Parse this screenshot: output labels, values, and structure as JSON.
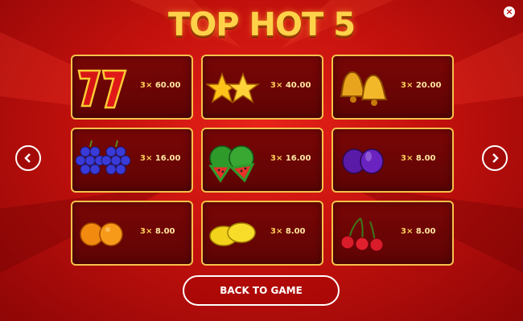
{
  "game": {
    "title": "TOP HOT 5"
  },
  "close_label": "×",
  "paytable": [
    {
      "symbol": "seven-icon",
      "multiplier": "3×",
      "payout": "60.00"
    },
    {
      "symbol": "star-icon",
      "multiplier": "3×",
      "payout": "40.00"
    },
    {
      "symbol": "bell-icon",
      "multiplier": "3×",
      "payout": "20.00"
    },
    {
      "symbol": "grapes-icon",
      "multiplier": "3×",
      "payout": "16.00"
    },
    {
      "symbol": "watermelon-icon",
      "multiplier": "3×",
      "payout": "16.00"
    },
    {
      "symbol": "plum-icon",
      "multiplier": "3×",
      "payout": "8.00"
    },
    {
      "symbol": "orange-icon",
      "multiplier": "3×",
      "payout": "8.00"
    },
    {
      "symbol": "lemon-icon",
      "multiplier": "3×",
      "payout": "8.00"
    },
    {
      "symbol": "cherry-icon",
      "multiplier": "3×",
      "payout": "8.00"
    }
  ],
  "navigation": {
    "prev_icon": "chevron-left-icon",
    "next_icon": "chevron-right-icon"
  },
  "back_button": {
    "label": "BACK TO GAME"
  },
  "colors": {
    "background": "#c4110d",
    "border": "#f6c24a",
    "panel": "#6a0505",
    "text": "#ffe6a0"
  }
}
